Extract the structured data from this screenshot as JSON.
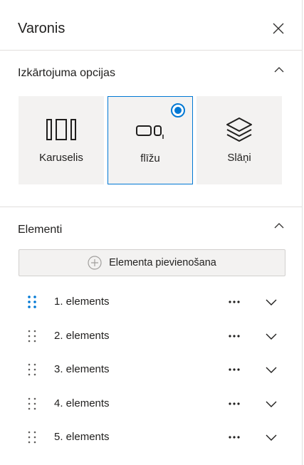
{
  "panel": {
    "title": "Varonis",
    "close_icon": "close-icon"
  },
  "layout_section": {
    "title": "Izkārtojuma opcijas",
    "collapse_icon": "chevron-up-icon",
    "options": [
      {
        "label": "Karuselis",
        "icon": "carousel-icon",
        "selected": false
      },
      {
        "label": "flīžu",
        "icon": "tiles-icon",
        "selected": true
      },
      {
        "label": "Slāņi",
        "icon": "layers-icon",
        "selected": false
      }
    ]
  },
  "items_section": {
    "title": "Elementi",
    "collapse_icon": "chevron-up-icon",
    "add_button_label": "Elementa pievienošana",
    "add_icon": "add-circle-icon",
    "items": [
      {
        "label": "1. elements",
        "active": true
      },
      {
        "label": "2. elements",
        "active": false
      },
      {
        "label": "3. elements",
        "active": false
      },
      {
        "label": "4. elements",
        "active": false
      },
      {
        "label": "5. elements",
        "active": false
      }
    ]
  },
  "colors": {
    "accent": "#0078d4",
    "tile_bg": "#f3f2f1",
    "divider": "#e1dfdd",
    "text": "#201f1e"
  }
}
